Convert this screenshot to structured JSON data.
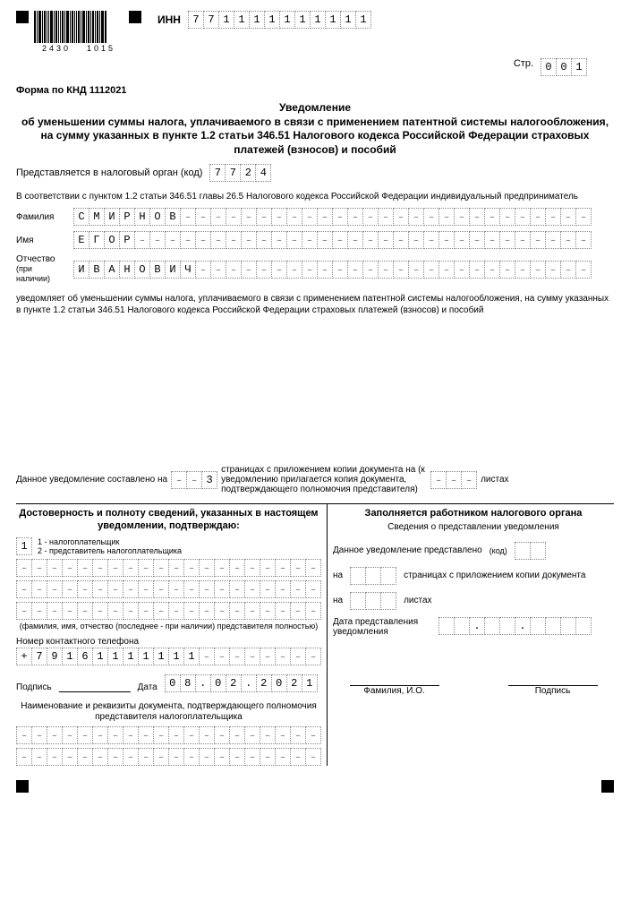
{
  "header": {
    "barcode_left": "2430",
    "barcode_right": "1015",
    "inn_label": "ИНН",
    "inn": [
      "7",
      "7",
      "1",
      "1",
      "1",
      "1",
      "1",
      "1",
      "1",
      "1",
      "1",
      "1"
    ],
    "str_label": "Стр.",
    "str": [
      "0",
      "0",
      "1"
    ],
    "form_code": "Форма по КНД 1112021",
    "title1": "Уведомление",
    "title2": "об уменьшении суммы налога, уплачиваемого в связи с применением патентной системы налогообложения, на сумму указанных в пункте 1.2 статьи 346.51 Налогового кодекса Российской Федерации страховых платежей (взносов) и пособий"
  },
  "body": {
    "org_label": "Представляется в налоговый орган (код)",
    "org_code": [
      "7",
      "7",
      "2",
      "4"
    ],
    "law_ref": "В соответствии с пунктом 1.2 статьи 346.51 главы 26.5 Налогового кодекса Российской Федерации индивидуальный предприниматель",
    "surname_label": "Фамилия",
    "surname": [
      "С",
      "М",
      "И",
      "Р",
      "Н",
      "О",
      "В"
    ],
    "name_label": "Имя",
    "name": [
      "Е",
      "Г",
      "О",
      "Р"
    ],
    "patr_label": "Отчество",
    "patr_sub": "(при наличии)",
    "patr": [
      "И",
      "В",
      "А",
      "Н",
      "О",
      "В",
      "И",
      "Ч"
    ],
    "notify_text": "уведомляет об уменьшении суммы налога, уплачиваемого в связи с применением патентной системы налогообложения, на сумму указанных в пункте 1.2 статьи 346.51 Налогового кодекса Российской Федерации страховых платежей (взносов) и пособий"
  },
  "pages": {
    "left_label": "Данное уведомление составлено на",
    "pages_val": [
      "",
      "",
      "3"
    ],
    "mid_text": "страницах с приложением копии документа на (к уведомлению прилагается копия документа, подтверждающего полномочия представителя)",
    "sheets_val": [
      "",
      "",
      ""
    ],
    "right_label": "листах"
  },
  "left": {
    "head": "Достоверность и полноту сведений, указанных в настоящем уведомлении, подтверждаю:",
    "type_val": "1",
    "type1": "1 - налогоплательщик",
    "type2": "2 - представитель налогоплательщика",
    "repr_label": "(фамилия, имя, отчество (последнее - при наличии) представителя полностью)",
    "phone_label": "Номер контактного телефона",
    "phone": [
      "+",
      "7",
      "9",
      "1",
      "6",
      "1",
      "1",
      "1",
      "1",
      "1",
      "1",
      "1"
    ],
    "sign_label": "Подпись",
    "date_label": "Дата",
    "date": [
      "0",
      "8",
      ".",
      "0",
      "2",
      ".",
      "2",
      "0",
      "2",
      "1"
    ],
    "doc_head": "Наименование и реквизиты документа, подтверждающего полномочия представителя налогоплательщика"
  },
  "right": {
    "head": "Заполняется работником налогового органа",
    "sub": "Сведения о представлении уведомления",
    "presented": "Данное уведомление представлено",
    "kod": "(код)",
    "na": "на",
    "pages_txt": "страницах с приложением копии документа",
    "sheets_txt": "листах",
    "date_label": "Дата представления уведомления",
    "fio": "Фамилия, И.О.",
    "sign": "Подпись"
  }
}
